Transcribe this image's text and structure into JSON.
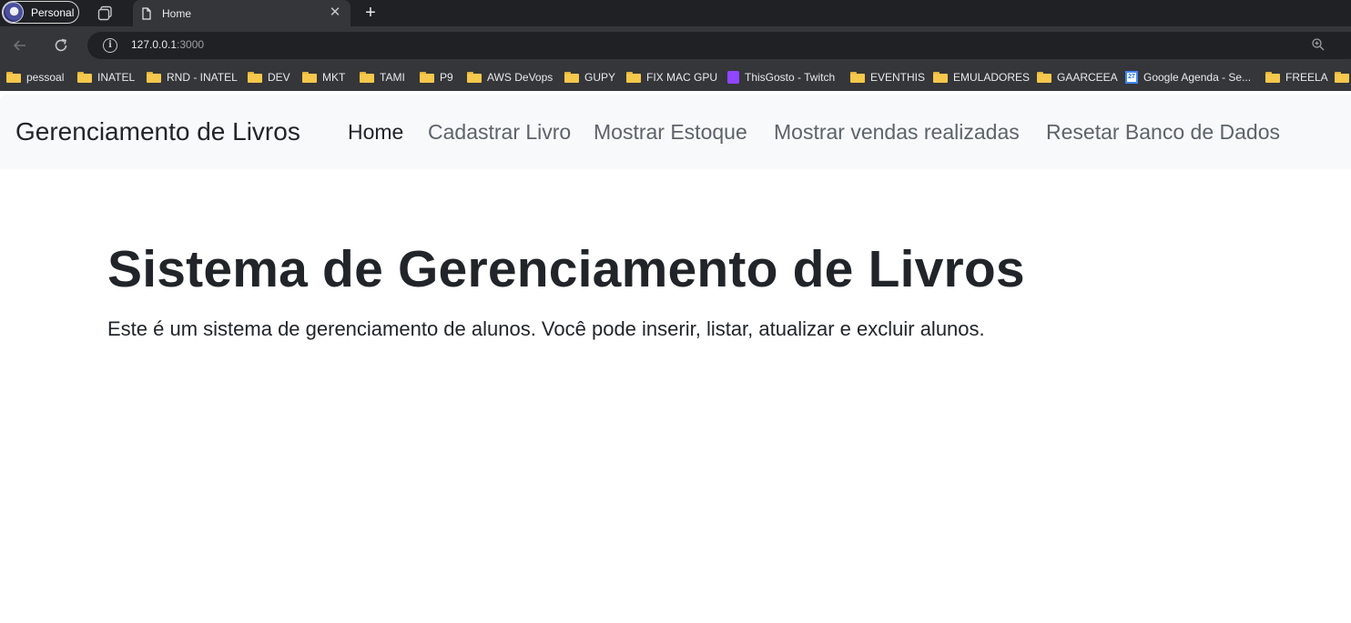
{
  "browser": {
    "profile_label": "Personal",
    "tab_title": "Home",
    "url_host": "127.0.0.1",
    "url_port": ":3000",
    "bookmarks": [
      {
        "label": "pessoal",
        "icon": "folder-icon"
      },
      {
        "label": "INATEL",
        "icon": "folder-icon"
      },
      {
        "label": "RND - INATEL",
        "icon": "folder-icon"
      },
      {
        "label": "DEV",
        "icon": "folder-icon"
      },
      {
        "label": "MKT",
        "icon": "folder-icon"
      },
      {
        "label": "TAMI",
        "icon": "folder-icon"
      },
      {
        "label": "P9",
        "icon": "folder-icon"
      },
      {
        "label": "AWS DeVops",
        "icon": "folder-icon"
      },
      {
        "label": "GUPY",
        "icon": "folder-icon"
      },
      {
        "label": "FIX MAC GPU",
        "icon": "folder-icon"
      },
      {
        "label": "ThisGosto - Twitch",
        "icon": "twitch-icon"
      },
      {
        "label": "EVENTHIS",
        "icon": "folder-icon"
      },
      {
        "label": "EMULADORES",
        "icon": "folder-icon"
      },
      {
        "label": "GAARCEEA",
        "icon": "folder-icon"
      },
      {
        "label": "Google Agenda - Se...",
        "icon": "google-calendar-icon",
        "calendar_day": "27"
      },
      {
        "label": "FREELA",
        "icon": "folder-icon"
      }
    ]
  },
  "navbar": {
    "brand": "Gerenciamento de Livros",
    "links": [
      {
        "label": "Home",
        "active": true
      },
      {
        "label": "Cadastrar Livro",
        "active": false
      },
      {
        "label": "Mostrar Estoque",
        "active": false
      },
      {
        "label": "Mostrar vendas realizadas",
        "active": false
      },
      {
        "label": "Resetar Banco de Dados",
        "active": false
      }
    ]
  },
  "hero": {
    "title": "Sistema de Gerenciamento de Livros",
    "text": "Este é um sistema de gerenciamento de alunos. Você pode inserir, listar, atualizar e excluir alunos."
  },
  "colors": {
    "navbar_bg": "#f8f9fa",
    "text_dark": "#212529",
    "nav_muted": "#5c636a",
    "chrome_dark": "#202124",
    "chrome_toolbar": "#35363a"
  }
}
